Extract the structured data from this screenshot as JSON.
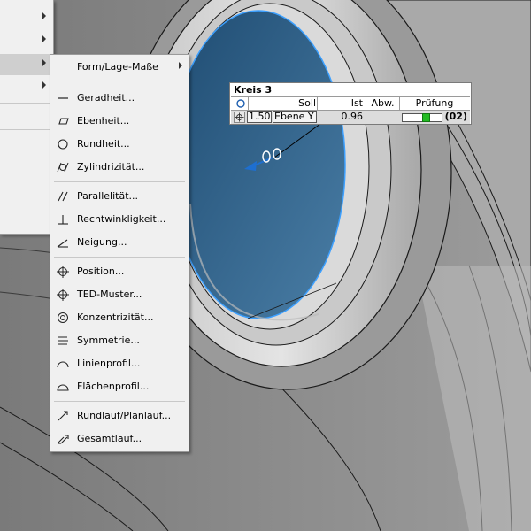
{
  "parent_menu": {
    "items": [
      {
        "has_submenu": true,
        "highlighted": false
      },
      {
        "has_submenu": true,
        "highlighted": false
      },
      {
        "has_submenu": true,
        "highlighted": true
      },
      {
        "has_submenu": true,
        "highlighted": false
      }
    ]
  },
  "submenu": {
    "header": "Form/Lage-Maße",
    "items": [
      {
        "label": "Geradheit...",
        "icon": "straightness-icon"
      },
      {
        "label": "Ebenheit...",
        "icon": "flatness-icon"
      },
      {
        "label": "Rundheit...",
        "icon": "circularity-icon"
      },
      {
        "label": "Zylindrizität...",
        "icon": "cylindricity-icon"
      },
      {
        "label": "Parallelität...",
        "icon": "parallelism-icon"
      },
      {
        "label": "Rechtwinkligkeit...",
        "icon": "perpendicularity-icon"
      },
      {
        "label": "Neigung...",
        "icon": "angularity-icon"
      },
      {
        "label": "Position...",
        "icon": "position-icon"
      },
      {
        "label": "TED-Muster...",
        "icon": "ted-pattern-icon"
      },
      {
        "label": "Konzentrizität...",
        "icon": "concentricity-icon"
      },
      {
        "label": "Symmetrie...",
        "icon": "symmetry-icon"
      },
      {
        "label": "Linienprofil...",
        "icon": "line-profile-icon"
      },
      {
        "label": "Flächenprofil...",
        "icon": "surface-profile-icon"
      },
      {
        "label": "Rundlauf/Planlauf...",
        "icon": "circular-runout-icon"
      },
      {
        "label": "Gesamtlauf...",
        "icon": "total-runout-icon"
      }
    ]
  },
  "measurement": {
    "title": "Kreis 3",
    "columns": {
      "soll": "Soll",
      "ist": "Ist",
      "abw": "Abw.",
      "pruefung": "Prüfung"
    },
    "row": {
      "tolerance": "1.50",
      "datum": "Ebene Y",
      "ist": "0.96",
      "abw": "",
      "pruefung_count": "(02)",
      "pruefung_level": 0.64
    }
  },
  "colors": {
    "part_gray": "#8c8c8c",
    "selected_face": "#2e5f86",
    "menu_bg": "#f0f0f0",
    "gauge_green": "#22bb22"
  }
}
